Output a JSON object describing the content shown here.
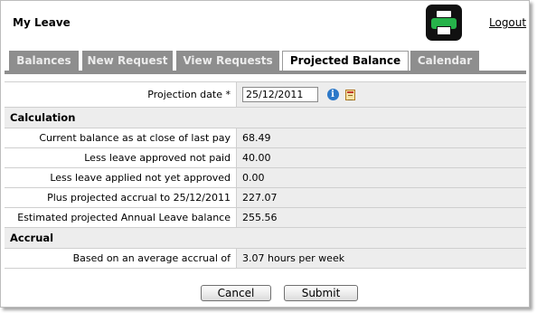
{
  "window": {
    "title": "My Leave",
    "logout_label": "Logout"
  },
  "icons": {
    "print": "printer-icon",
    "info": "info-icon",
    "calendar": "calendar-icon"
  },
  "tabs": [
    {
      "label": "Balances",
      "active": false
    },
    {
      "label": "New Request",
      "active": false
    },
    {
      "label": "View Requests",
      "active": false
    },
    {
      "label": "Projected Balance",
      "active": true
    },
    {
      "label": "Calendar",
      "active": false
    }
  ],
  "projection": {
    "label": "Projection date *",
    "value": "25/12/2011",
    "info_glyph": "i"
  },
  "calculation": {
    "heading": "Calculation",
    "rows": [
      {
        "label": "Current balance as at close of last pay",
        "value": "68.49"
      },
      {
        "label": "Less leave approved not paid",
        "value": "40.00"
      },
      {
        "label": "Less leave applied not yet approved",
        "value": "0.00"
      },
      {
        "label": "Plus projected accrual to 25/12/2011",
        "value": "227.07"
      },
      {
        "label": "Estimated projected Annual Leave balance",
        "value": "255.56"
      }
    ]
  },
  "accrual": {
    "heading": "Accrual",
    "rows": [
      {
        "label": "Based on an average accrual of",
        "value": "3.07 hours per week"
      }
    ]
  },
  "buttons": {
    "cancel": "Cancel",
    "submit": "Submit"
  },
  "colors": {
    "tab_inactive": "#8e8e8e",
    "row_shade": "#ededed",
    "info_blue": "#2c78c8",
    "printer_green": "#26b34a"
  }
}
